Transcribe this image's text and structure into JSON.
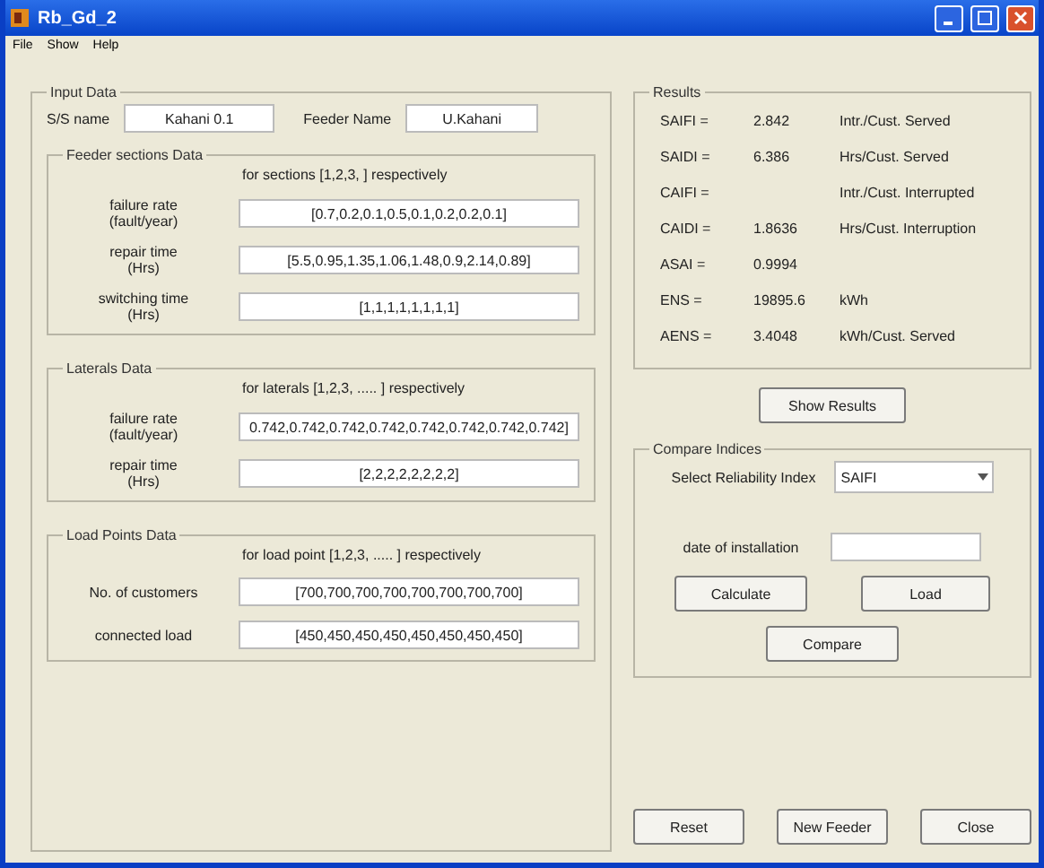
{
  "window": {
    "title": "Rb_Gd_2"
  },
  "menu": [
    "File",
    "Show",
    "Help"
  ],
  "input_data": {
    "title": "Input Data",
    "ss_label": "S/S name",
    "ss_value": "Kahani 0.1",
    "feeder_label": "Feeder Name",
    "feeder_value": "U.Kahani",
    "groups": [
      {
        "title": "Feeder sections Data",
        "note": "for sections [1,2,3,      ] respectively",
        "fields": [
          {
            "label": [
              "failure rate",
              "(fault/year)"
            ],
            "value": "[0.7,0.2,0.1,0.5,0.1,0.2,0.2,0.1]"
          },
          {
            "label": [
              "repair time",
              "(Hrs)"
            ],
            "value": "[5.5,0.95,1.35,1.06,1.48,0.9,2.14,0.89]"
          },
          {
            "label": [
              "switching time",
              "(Hrs)"
            ],
            "value": "[1,1,1,1,1,1,1,1]"
          }
        ]
      },
      {
        "title": "Laterals Data",
        "note": "for laterals [1,2,3, ..... ] respectively",
        "fields": [
          {
            "label": [
              "failure rate",
              "(fault/year)"
            ],
            "value": "0.742,0.742,0.742,0.742,0.742,0.742,0.742,0.742]"
          },
          {
            "label": [
              "repair time",
              "(Hrs)"
            ],
            "value": "[2,2,2,2,2,2,2,2]"
          }
        ]
      },
      {
        "title": "Load Points Data",
        "note": "for load point [1,2,3, ..... ] respectively",
        "fields": [
          {
            "label": [
              "No. of customers"
            ],
            "value": "[700,700,700,700,700,700,700,700]"
          },
          {
            "label": [
              "connected load"
            ],
            "value": "[450,450,450,450,450,450,450,450]"
          }
        ]
      }
    ]
  },
  "results": {
    "title": "Results",
    "rows": [
      {
        "name": "SAIFI =",
        "value": "2.842",
        "unit": "Intr./Cust. Served"
      },
      {
        "name": "SAIDI =",
        "value": "6.386",
        "unit": "Hrs/Cust. Served"
      },
      {
        "name": "CAIFI =",
        "value": "",
        "unit": "Intr./Cust. Interrupted"
      },
      {
        "name": "CAIDI =",
        "value": "1.8636",
        "unit": "Hrs/Cust. Interruption"
      },
      {
        "name": "ASAI =",
        "value": "0.9994",
        "unit": ""
      },
      {
        "name": "ENS =",
        "value": "19895.6",
        "unit": "kWh"
      },
      {
        "name": "AENS =",
        "value": "3.4048",
        "unit": "kWh/Cust. Served"
      }
    ]
  },
  "show_results": "Show Results",
  "compare": {
    "title": "Compare Indices",
    "select_label": "Select Reliability Index",
    "select_value": "SAIFI",
    "date_label": "date of installation",
    "buttons": [
      "Calculate",
      "Load",
      "Compare"
    ]
  },
  "footer_buttons": [
    "Reset",
    "New Feeder",
    "Close"
  ]
}
